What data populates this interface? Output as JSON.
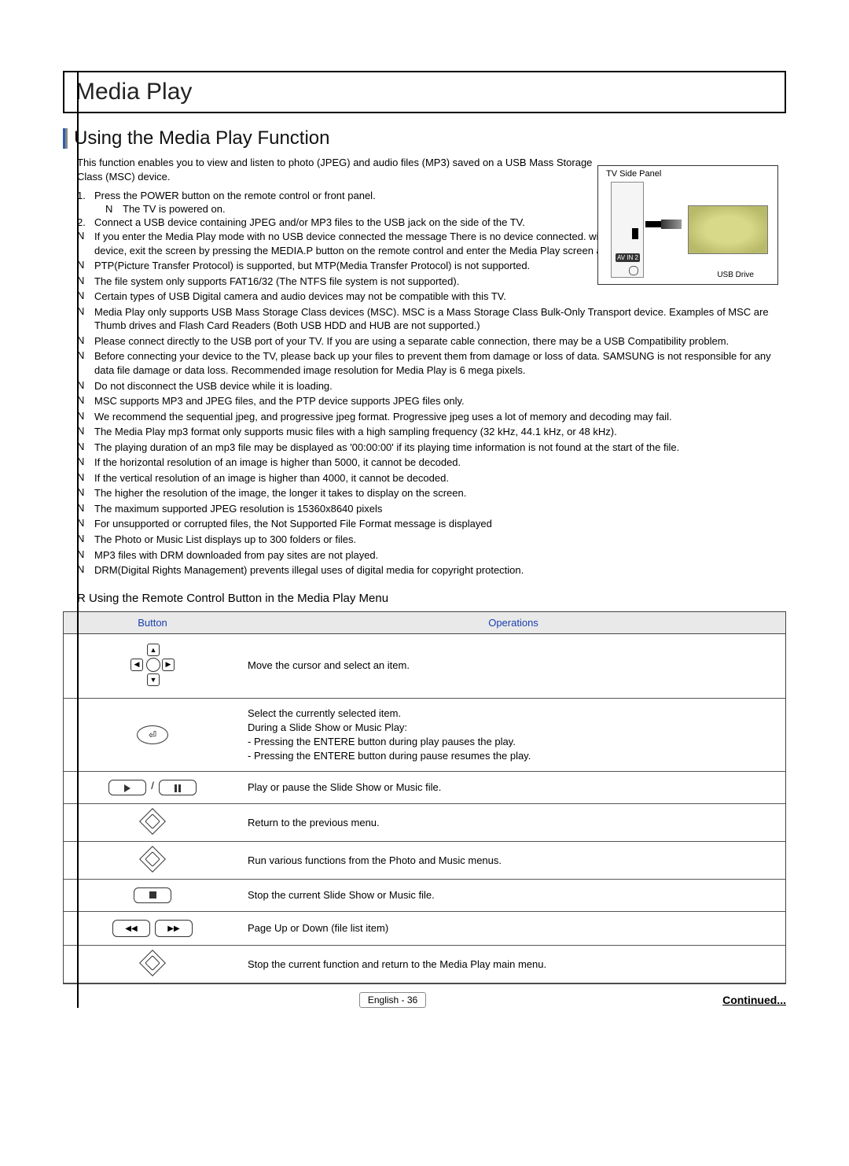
{
  "chapter": "Media Play",
  "section": "Using the Media Play Function",
  "intro": "This function enables you to view and listen to photo (JPEG) and audio files (MP3) saved on a USB Mass Storage Class (MSC) device.",
  "side_panel_label": "TV Side Panel",
  "side_panel_av": "AV\nIN 2",
  "side_panel_drive": "USB Drive",
  "steps": [
    {
      "num": "1.",
      "text": "Press the POWER button on the remote control or front panel.",
      "sub": [
        {
          "mark": "N",
          "text": "The TV is powered on."
        }
      ]
    },
    {
      "num": "2.",
      "text": "Connect a USB device containing JPEG and/or MP3 files to the USB jack on the side of the TV.",
      "sub": []
    }
  ],
  "notes": [
    "If you enter the Media Play mode with no USB device connected the message There is no device connected.   will appear. In this case, insert the USB device, exit the screen by pressing the MEDIA.P button on the remote control and enter the Media Play screen again.",
    "PTP(Picture Transfer Protocol) is supported, but MTP(Media Transfer Protocol) is not supported.",
    "The file system only supports FAT16/32 (The NTFS file system is not supported).",
    "Certain types of USB Digital camera and audio devices may not be compatible with this TV.",
    "Media Play only supports USB Mass Storage Class devices (MSC). MSC is a Mass Storage Class Bulk-Only Transport device. Examples of MSC are Thumb drives and Flash Card Readers (Both USB HDD and HUB are not supported.)",
    "Please connect directly to the USB port of your TV. If you are using a separate cable connection, there may be a USB Compatibility problem.",
    "Before connecting your device to the TV, please back up your files to prevent them from damage or loss of data. SAMSUNG is not responsible for any data file damage or data loss. Recommended image resolution for Media Play is 6 mega pixels.",
    "Do not disconnect the USB device while it is loading.",
    "MSC supports MP3 and JPEG files, and the PTP device supports JPEG files only.",
    "We recommend the sequential jpeg, and progressive jpeg format. Progressive jpeg uses a lot of memory and decoding may fail.",
    "The Media Play mp3 format only supports music files with a high sampling frequency (32 kHz, 44.1 kHz, or 48 kHz).",
    "The playing duration of an mp3 file may be displayed as '00:00:00' if its playing time information is not found at the start of the file.",
    "If the horizontal resolution of an image is higher than 5000, it cannot be decoded.",
    "If the vertical resolution of an image is higher than 4000, it cannot be decoded.",
    "The higher the resolution of the image, the longer it takes to display on the screen.",
    "The maximum supported JPEG resolution is 15360x8640 pixels",
    "For unsupported or corrupted files, the Not Supported File Format message is displayed",
    "The Photo or Music List displays up to 300 folders or files.",
    "MP3 files with DRM downloaded from pay sites are not played.",
    "DRM(Digital Rights Management) prevents illegal uses of digital media for copyright protection."
  ],
  "note_mark": "N",
  "subhead": "R  Using the Remote Control Button in the Media Play Menu",
  "table": {
    "headers": {
      "c1": "Button",
      "c2": "Operations"
    },
    "rows": [
      {
        "icon": "dpad",
        "op": "Move the cursor and select an item."
      },
      {
        "icon": "enter",
        "op": "Select the currently selected item.\nDuring a Slide Show or Music Play:\n- Pressing the ENTERE   button during play pauses the play.\n- Pressing the ENTERE   button during pause resumes the play."
      },
      {
        "icon": "playpause",
        "op": "Play or pause the Slide Show or Music file."
      },
      {
        "icon": "return",
        "op": "Return to the previous menu."
      },
      {
        "icon": "tools",
        "op": "Run various functions from the Photo and Music menus."
      },
      {
        "icon": "stop",
        "op": "Stop the current Slide Show or Music file."
      },
      {
        "icon": "rewff",
        "op": "Page Up or Down (file list item)"
      },
      {
        "icon": "exit",
        "op": "Stop the current function and return to the Media Play  main menu."
      }
    ]
  },
  "footer_page": "English - 36",
  "footer_continued": "Continued..."
}
